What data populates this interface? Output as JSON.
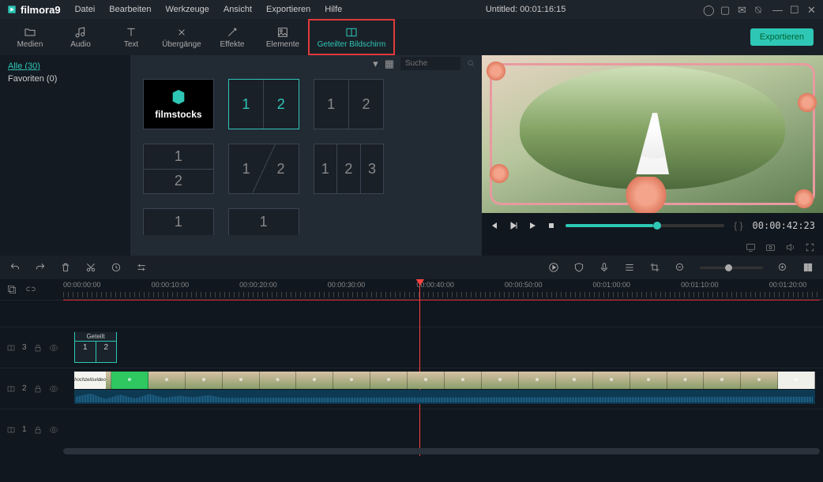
{
  "app": {
    "name": "filmora",
    "version": "9"
  },
  "menu": {
    "items": [
      "Datei",
      "Bearbeiten",
      "Werkzeuge",
      "Ansicht",
      "Exportieren",
      "Hilfe"
    ]
  },
  "title": {
    "name": "Untitled:",
    "timecode": "00:01:16:15"
  },
  "window_icons": [
    "user",
    "save",
    "mail",
    "mic",
    "minimize",
    "maximize",
    "close"
  ],
  "tabs": {
    "items": [
      {
        "id": "medien",
        "label": "Medien",
        "icon": "folder"
      },
      {
        "id": "audio",
        "label": "Audio",
        "icon": "music"
      },
      {
        "id": "text",
        "label": "Text",
        "icon": "text"
      },
      {
        "id": "ubergange",
        "label": "Übergänge",
        "icon": "transition"
      },
      {
        "id": "effekte",
        "label": "Effekte",
        "icon": "wand"
      },
      {
        "id": "elemente",
        "label": "Elemente",
        "icon": "image"
      },
      {
        "id": "geteilter",
        "label": "Geteilter Bildschirm",
        "icon": "split",
        "active": true
      }
    ],
    "export": "Exportieren"
  },
  "sidebar": {
    "items": [
      {
        "label": "Alle (30)",
        "active": true
      },
      {
        "label": "Favoriten (0)",
        "active": false
      }
    ]
  },
  "browser": {
    "search_placeholder": "Suche",
    "tiles": [
      {
        "kind": "filmstocks",
        "label": "filmstocks"
      },
      {
        "kind": "split2",
        "cells": [
          "1",
          "2"
        ],
        "selected": true
      },
      {
        "kind": "split2",
        "cells": [
          "1",
          "2"
        ]
      },
      {
        "kind": "stack2",
        "cells": [
          "1",
          "2"
        ]
      },
      {
        "kind": "diag2",
        "cells": [
          "1",
          "2"
        ]
      },
      {
        "kind": "split3",
        "cells": [
          "1",
          "2",
          "3"
        ]
      },
      {
        "kind": "partial",
        "cells": [
          "1"
        ]
      },
      {
        "kind": "partial",
        "cells": [
          "1"
        ]
      }
    ]
  },
  "preview": {
    "timecode": "00:00:42:23",
    "controls": [
      "prev",
      "play-pause",
      "play",
      "stop"
    ],
    "braces": "{   }",
    "footer_icons": [
      "send-to-monitor",
      "camera",
      "volume",
      "fullscreen"
    ]
  },
  "actionbar": {
    "left": [
      "undo",
      "redo",
      "delete",
      "cut",
      "record-marker",
      "settings-sliders"
    ],
    "right": [
      "play-circle",
      "shield",
      "mic",
      "stack",
      "crop",
      "zoom-out",
      "zoom-in",
      "panel"
    ]
  },
  "timeline": {
    "header_icons": [
      "copy",
      "unlink"
    ],
    "ticks": [
      "00:00:00:00",
      "00:00:10:00",
      "00:00:20:00",
      "00:00:30:00",
      "00:00:40:00",
      "00:00:50:00",
      "00:01:00:00",
      "00:01:10:00",
      "00:01:20:00"
    ],
    "playhead_tc": "00:00:40:00",
    "tracks": [
      {
        "id": 3,
        "icons": [
          "split",
          "lock",
          "eye"
        ],
        "clip": {
          "label": "Geteilt",
          "cells": [
            "1",
            "2"
          ]
        }
      },
      {
        "id": 2,
        "icons": [
          "split",
          "lock",
          "eye"
        ],
        "video_label": "hochzeitsvideo"
      },
      {
        "id": 1,
        "icons": [
          "split",
          "lock",
          "eye"
        ]
      }
    ]
  }
}
